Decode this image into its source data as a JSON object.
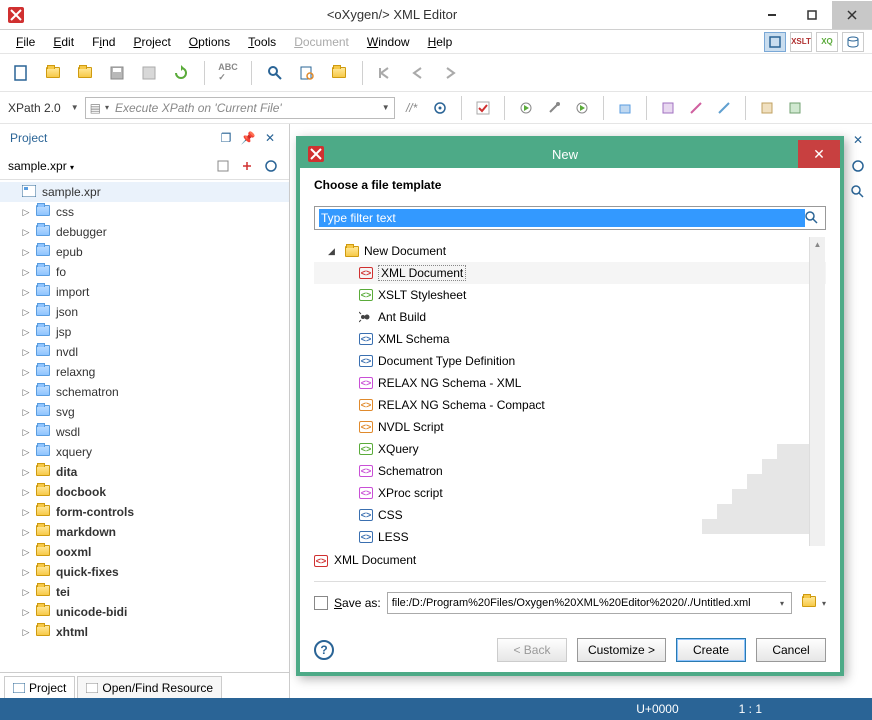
{
  "titlebar": {
    "title": "<oXygen/> XML Editor"
  },
  "menu": {
    "items": [
      "File",
      "Edit",
      "Find",
      "Project",
      "Options",
      "Tools",
      "Document",
      "Window",
      "Help"
    ],
    "disabled_index": 6
  },
  "xpath": {
    "label": "XPath 2.0",
    "placeholder": "Execute XPath on  'Current File'"
  },
  "project_panel": {
    "title": "Project",
    "file": "sample.xpr",
    "tabs": {
      "project": "Project",
      "openfind": "Open/Find Resource"
    },
    "root": "sample.xpr",
    "items": [
      {
        "label": "css",
        "bold": false,
        "yellow": false
      },
      {
        "label": "debugger",
        "bold": false,
        "yellow": false
      },
      {
        "label": "epub",
        "bold": false,
        "yellow": false
      },
      {
        "label": "fo",
        "bold": false,
        "yellow": false
      },
      {
        "label": "import",
        "bold": false,
        "yellow": false
      },
      {
        "label": "json",
        "bold": false,
        "yellow": false
      },
      {
        "label": "jsp",
        "bold": false,
        "yellow": false
      },
      {
        "label": "nvdl",
        "bold": false,
        "yellow": false
      },
      {
        "label": "relaxng",
        "bold": false,
        "yellow": false
      },
      {
        "label": "schematron",
        "bold": false,
        "yellow": false
      },
      {
        "label": "svg",
        "bold": false,
        "yellow": false
      },
      {
        "label": "wsdl",
        "bold": false,
        "yellow": false
      },
      {
        "label": "xquery",
        "bold": false,
        "yellow": false
      },
      {
        "label": "dita",
        "bold": true,
        "yellow": true
      },
      {
        "label": "docbook",
        "bold": true,
        "yellow": true
      },
      {
        "label": "form-controls",
        "bold": true,
        "yellow": true
      },
      {
        "label": "markdown",
        "bold": true,
        "yellow": true
      },
      {
        "label": "ooxml",
        "bold": true,
        "yellow": true
      },
      {
        "label": "quick-fixes",
        "bold": true,
        "yellow": true
      },
      {
        "label": "tei",
        "bold": true,
        "yellow": true
      },
      {
        "label": "unicode-bidi",
        "bold": true,
        "yellow": true
      },
      {
        "label": "xhtml",
        "bold": true,
        "yellow": true
      }
    ]
  },
  "dialog": {
    "title": "New",
    "heading": "Choose a file template",
    "filter_placeholder": "Type filter text",
    "root": "New Document",
    "templates": [
      {
        "label": "XML Document",
        "color": "#d03030",
        "selected": true
      },
      {
        "label": "XSLT Stylesheet",
        "color": "#5aab3a"
      },
      {
        "label": "Ant Build",
        "color": "#555",
        "icon": "ant"
      },
      {
        "label": "XML Schema",
        "color": "#3a6fb0"
      },
      {
        "label": "Document Type Definition",
        "color": "#3a6fb0"
      },
      {
        "label": "RELAX NG Schema - XML",
        "color": "#c94fd6"
      },
      {
        "label": "RELAX NG Schema - Compact",
        "color": "#e08a2c"
      },
      {
        "label": "NVDL Script",
        "color": "#e08a2c"
      },
      {
        "label": "XQuery",
        "color": "#5aab3a"
      },
      {
        "label": "Schematron",
        "color": "#c94fd6"
      },
      {
        "label": "XProc script",
        "color": "#c94fd6"
      },
      {
        "label": "CSS",
        "color": "#3a6fb0"
      },
      {
        "label": "LESS",
        "color": "#3a6fb0"
      }
    ],
    "selected_label": "XML Document",
    "saveas_label": "Save as:",
    "saveas_value": "file:/D:/Program%20Files/Oxygen%20XML%20Editor%2020/./Untitled.xml",
    "buttons": {
      "back": "< Back",
      "customize": "Customize >",
      "create": "Create",
      "cancel": "Cancel"
    }
  },
  "statusbar": {
    "code": "U+0000",
    "pos": "1 : 1"
  }
}
